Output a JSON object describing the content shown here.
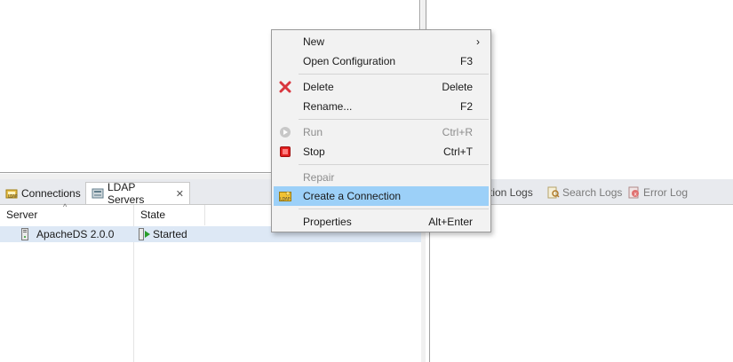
{
  "left_tabs": {
    "connections": "Connections",
    "ldap_servers": "LDAP Servers",
    "close": "✕"
  },
  "servers_table": {
    "columns": [
      "Server",
      "State"
    ],
    "sort_indicator": "^",
    "rows": [
      {
        "server": "ApacheDS 2.0.0",
        "state": "Started"
      }
    ]
  },
  "right_tabs": {
    "modification_logs_partial": "tion Logs",
    "search_logs": "Search Logs",
    "error_log": "Error Log"
  },
  "context_menu": {
    "items": [
      {
        "label": "New",
        "accelerator": "›",
        "enabled": true
      },
      {
        "label": "Open Configuration",
        "accelerator": "F3",
        "enabled": true
      },
      {
        "label": "Delete",
        "accelerator": "Delete",
        "enabled": true,
        "icon": "delete-x-icon"
      },
      {
        "label": "Rename...",
        "accelerator": "F2",
        "enabled": true
      },
      {
        "label": "Run",
        "accelerator": "Ctrl+R",
        "enabled": false,
        "icon": "run-icon"
      },
      {
        "label": "Stop",
        "accelerator": "Ctrl+T",
        "enabled": true,
        "icon": "stop-icon"
      },
      {
        "label": "Repair",
        "accelerator": "",
        "enabled": false
      },
      {
        "label": "Create a Connection",
        "accelerator": "",
        "enabled": true,
        "icon": "ldap-connection-icon",
        "highlighted": true
      },
      {
        "label": "Properties",
        "accelerator": "Alt+Enter",
        "enabled": true
      }
    ]
  },
  "colors": {
    "highlight": "#9cd0f8",
    "selected_row": "#dde8f5",
    "delete_icon": "#d9363e",
    "stop_icon": "#e02020",
    "started_icon": "#2a9d2a"
  }
}
